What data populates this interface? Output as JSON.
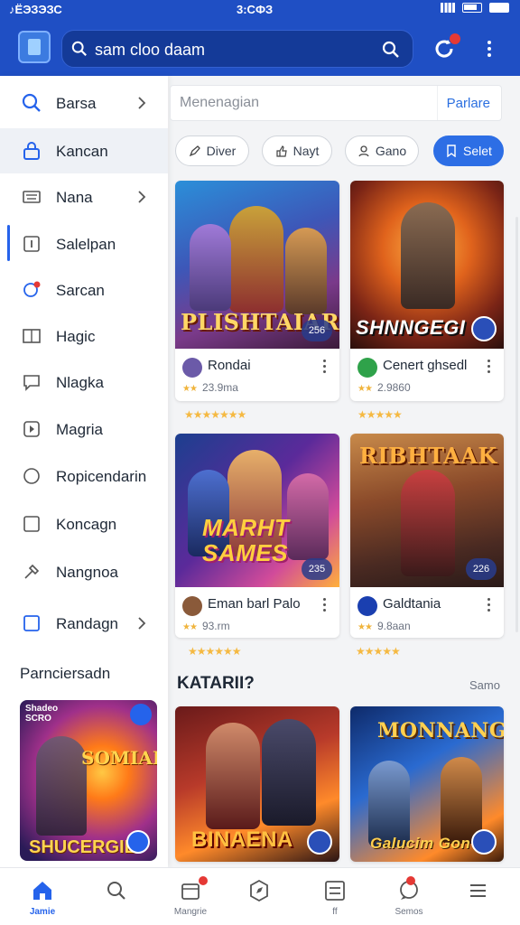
{
  "status_bar": {
    "left": "♪ЁЭЗЭЗС",
    "time": "3:СФЗ"
  },
  "header": {
    "search_text": "sam cloo daam"
  },
  "sidebar": {
    "items": [
      {
        "label": "Barsa",
        "icon": "search-icon",
        "has_chevron": true
      },
      {
        "label": "Kancan",
        "icon": "lock-icon",
        "has_chevron": false,
        "active": true
      },
      {
        "label": "Nana",
        "icon": "keyboard-icon",
        "has_chevron": true
      },
      {
        "label": "Salelpan",
        "icon": "info-box-icon",
        "has_chevron": false
      },
      {
        "label": "Sarcan",
        "icon": "notification-search-icon",
        "has_chevron": false
      },
      {
        "label": "Hagic",
        "icon": "book-icon",
        "has_chevron": false
      },
      {
        "label": "Nlagka",
        "icon": "chat-icon",
        "has_chevron": false
      },
      {
        "label": "Magria",
        "icon": "play-box-icon",
        "has_chevron": false
      },
      {
        "label": "Ropicendarin",
        "icon": "circle-icon",
        "has_chevron": false
      },
      {
        "label": "Koncagn",
        "icon": "square-icon",
        "has_chevron": false
      },
      {
        "label": "Nangnoa",
        "icon": "tools-icon",
        "has_chevron": false
      },
      {
        "label": "Randagn",
        "icon": "square-blue-icon",
        "has_chevron": true
      }
    ],
    "section_title": "Parnciersadn",
    "promo": {
      "tag": "Shadeo\nSCRO",
      "title_top": "SOMIALE",
      "title_bottom": "SHUCERGIE"
    }
  },
  "main": {
    "search_placeholder": "Menenagian",
    "search_button": "Parlare",
    "chips": [
      {
        "label": "Diver",
        "icon": "pencil-icon"
      },
      {
        "label": "Nayt",
        "icon": "thumbs-up-icon"
      },
      {
        "label": "Gano",
        "icon": "user-icon"
      },
      {
        "label": "Selet",
        "icon": "bookmark-icon",
        "primary": true
      }
    ],
    "cards": [
      {
        "title": "PLISHTAIAR",
        "name": "Rondai",
        "rating": "23.9ma",
        "badge": "256"
      },
      {
        "title": "SHNNGEGI",
        "name": "Cenert ghsedl",
        "rating": "2.9860",
        "badge": ""
      },
      {
        "title": "MARHT SAMES",
        "name": "Eman barl Palo",
        "rating": "93.rm",
        "badge": "235"
      },
      {
        "title": "RIBHTAAK",
        "name": "Galdtania",
        "rating": "9.8aan",
        "badge": "226"
      }
    ],
    "section_title": "KATARII?",
    "section_link": "Samo",
    "more_cards": [
      {
        "title": "BINAENA"
      },
      {
        "title": "MONNANG",
        "subtitle": "Galucim Gon"
      }
    ]
  },
  "bottom_nav": [
    {
      "label": "Jamie",
      "icon": "home-icon",
      "active": true
    },
    {
      "label": "",
      "icon": "search-icon"
    },
    {
      "label": "Mangrie",
      "icon": "calendar-icon",
      "dot": true
    },
    {
      "label": "",
      "icon": "compass-icon"
    },
    {
      "label": "ff",
      "icon": "list-box-icon"
    },
    {
      "label": "Semos",
      "icon": "chat-bubble-icon",
      "dot": true
    },
    {
      "label": "",
      "icon": "menu-icon"
    }
  ],
  "colors": {
    "brand": "#1f4fc4",
    "accent": "#2d6ee5",
    "star": "#f5b942",
    "badge_dot": "#e53935"
  }
}
